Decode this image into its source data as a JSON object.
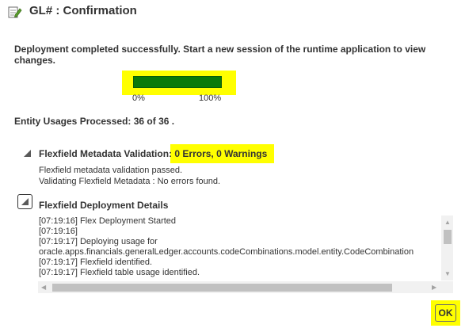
{
  "dialog": {
    "title": "GL# : Confirmation",
    "icon": "edit-document-icon"
  },
  "message": "Deployment completed successfully. Start a new session of the runtime application to view changes.",
  "progress": {
    "value_percent": 100,
    "min_label": "0%",
    "max_label": "100%",
    "color": "#0a7a0a"
  },
  "entity_usages": "Entity Usages Processed: 36 of 36 .",
  "validation": {
    "heading": "Flexfield Metadata Validation:",
    "summary": " 0 Errors, 0 Warnings",
    "lines": [
      "Flexfield metadata validation passed.",
      "Validating Flexfield Metadata : No errors found."
    ]
  },
  "deployment": {
    "heading": "Flexfield Deployment Details",
    "log": [
      "[07:19:16] Flex Deployment Started",
      "[07:19:16]",
      "[07:19:17] Deploying usage for",
      "oracle.apps.financials.generalLedger.accounts.codeCombinations.model.entity.CodeCombination",
      "[07:19:17] Flexfield identified.",
      "[07:19:17] Flexfield table usage identified."
    ]
  },
  "buttons": {
    "ok": "OK"
  },
  "highlight_color": "#ffff00"
}
